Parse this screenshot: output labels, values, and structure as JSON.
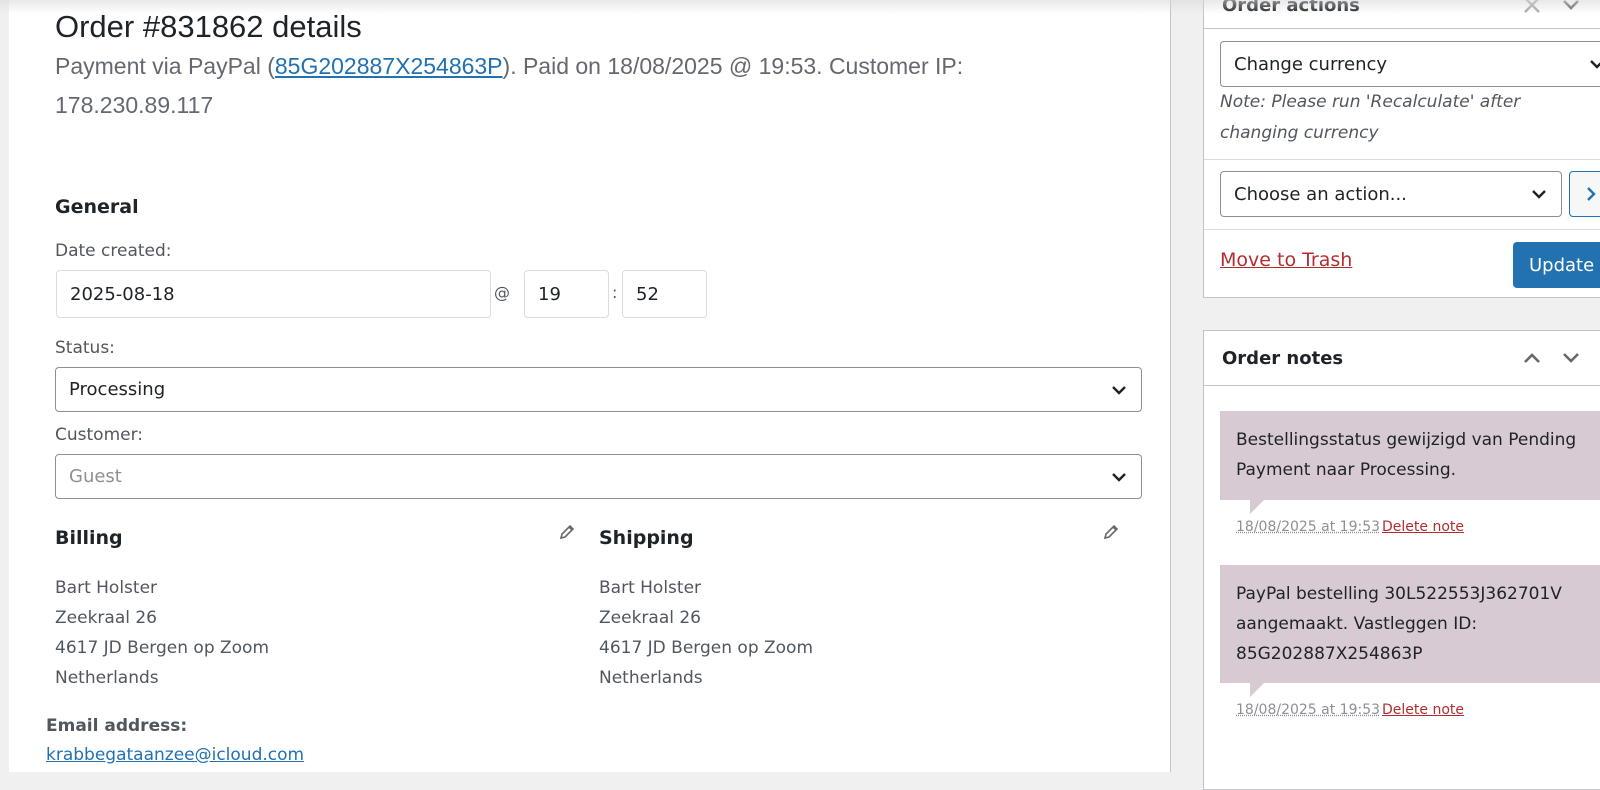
{
  "order": {
    "title": "Order #831862 details",
    "payment_prefix": "Payment via PayPal (",
    "transaction_id": "85G202887X254863P",
    "payment_suffix": "). Paid on 18/08/2025 @ 19:53. Customer IP: 178.230.89.117"
  },
  "general": {
    "heading": "General",
    "date_label": "Date created:",
    "date_value": "2025-08-18",
    "at_sep": "@",
    "hour_value": "19",
    "colon_sep": ":",
    "minute_value": "52",
    "status_label": "Status:",
    "status_value": "Processing",
    "customer_label": "Customer:",
    "customer_value": "Guest"
  },
  "billing": {
    "heading": "Billing",
    "lines": [
      "Bart Holster",
      "Zeekraal 26",
      "4617 JD Bergen op Zoom",
      "Netherlands"
    ],
    "email_label": "Email address:",
    "email": "krabbegataanzee@icloud.com"
  },
  "shipping": {
    "heading": "Shipping",
    "lines": [
      "Bart Holster",
      "Zeekraal 26",
      "4617 JD Bergen op Zoom",
      "Netherlands"
    ]
  },
  "order_actions": {
    "title": "Order actions",
    "currency_select": "Change currency",
    "currency_note": "Note: Please run 'Recalculate' after changing currency",
    "action_select": "Choose an action...",
    "trash_label": "Move to Trash",
    "update_label": "Update"
  },
  "order_notes": {
    "title": "Order notes",
    "notes": [
      {
        "text": "Bestellingsstatus gewijzigd van Pending Payment naar Processing.",
        "timestamp": "18/08/2025 at 19:53",
        "delete_label": "Delete note"
      },
      {
        "text": "PayPal bestelling 30L522553J362701V aangemaakt. Vastleggen ID: 85G202887X254863P",
        "timestamp": "18/08/2025 at 19:53",
        "delete_label": "Delete note"
      }
    ]
  },
  "colors": {
    "link": "#2271b1",
    "danger": "#b32d2e",
    "primary_button": "#2271b1",
    "note_bubble": "#d7cad2"
  },
  "icons": [
    "chevron-down-icon",
    "chevron-up-icon",
    "chevron-right-icon",
    "pencil-icon",
    "close-icon"
  ]
}
